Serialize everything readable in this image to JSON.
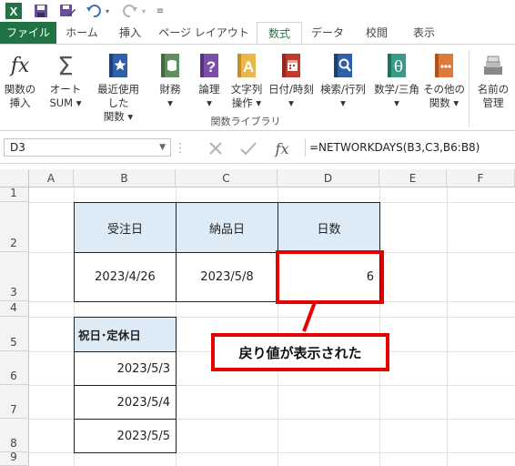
{
  "qat": {
    "app_icon": "excel-icon",
    "save_icon": "save-icon",
    "undo_icon": "undo-icon",
    "redo_icon": "redo-icon"
  },
  "tabs": [
    "ファイル",
    "ホーム",
    "挿入",
    "ページ レイアウト",
    "数式",
    "データ",
    "校閲",
    "表示"
  ],
  "active_tab": "数式",
  "ribbon": {
    "buttons": [
      {
        "label": "関数の\n挿入",
        "icon": "function-icon"
      },
      {
        "label": "オート\nSUM ▾",
        "icon": "sigma-icon"
      },
      {
        "label": "最近使用した\n関数 ▾",
        "icon": "star-book-icon"
      },
      {
        "label": "財務\n▾",
        "icon": "finance-icon"
      },
      {
        "label": "論理\n▾",
        "icon": "logic-icon"
      },
      {
        "label": "文字列\n操作 ▾",
        "icon": "text-icon"
      },
      {
        "label": "日付/時刻\n▾",
        "icon": "calendar-icon"
      },
      {
        "label": "検索/行列\n▾",
        "icon": "lookup-icon"
      },
      {
        "label": "数学/三角\n▾",
        "icon": "math-icon"
      },
      {
        "label": "その他の\n関数 ▾",
        "icon": "more-functions-icon"
      },
      {
        "label": "名前の\n管理",
        "icon": "name-manager-icon"
      }
    ],
    "group_label": "関数ライブラリ"
  },
  "formula_bar": {
    "name_box": "D3",
    "formula": "=NETWORKDAYS(B3,C3,B6:B8)",
    "fx": "fx"
  },
  "columns": [
    "A",
    "B",
    "C",
    "D",
    "E",
    "F"
  ],
  "rows": [
    "1",
    "2",
    "3",
    "4",
    "5",
    "6",
    "7",
    "8",
    "9"
  ],
  "table": {
    "headers": [
      "受注日",
      "納品日",
      "日数"
    ],
    "order_date": "2023/4/26",
    "delivery_date": "2023/5/8",
    "days": "6"
  },
  "holidays": {
    "header": "祝日･定休日",
    "dates": [
      "2023/5/3",
      "2023/5/4",
      "2023/5/5"
    ]
  },
  "callout": "戻り値が表示された",
  "colors": {
    "excel_green": "#217346",
    "header_fill": "#ddebf7",
    "highlight_red": "#e60000"
  }
}
